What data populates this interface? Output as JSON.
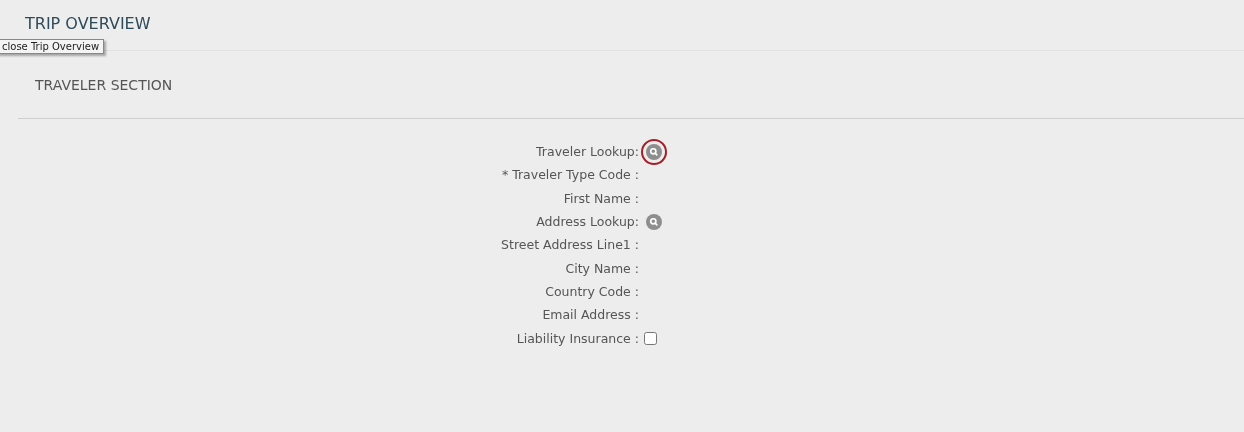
{
  "page": {
    "title": "TRIP OVERVIEW"
  },
  "tooltip": {
    "text": "close Trip Overview"
  },
  "section": {
    "title": "TRAVELER SECTION"
  },
  "fields": [
    {
      "label": "Traveler Lookup:",
      "kind": "lookup",
      "highlighted": true
    },
    {
      "label": "* Traveler Type Code :",
      "kind": "text"
    },
    {
      "label": "First Name :",
      "kind": "text"
    },
    {
      "label": "Address Lookup:",
      "kind": "lookup",
      "highlighted": false
    },
    {
      "label": "Street Address Line1 :",
      "kind": "text"
    },
    {
      "label": "City Name :",
      "kind": "text"
    },
    {
      "label": "Country Code :",
      "kind": "text"
    },
    {
      "label": "Email Address :",
      "kind": "text"
    },
    {
      "label": "Liability Insurance :",
      "kind": "checkbox",
      "checked": false
    }
  ]
}
